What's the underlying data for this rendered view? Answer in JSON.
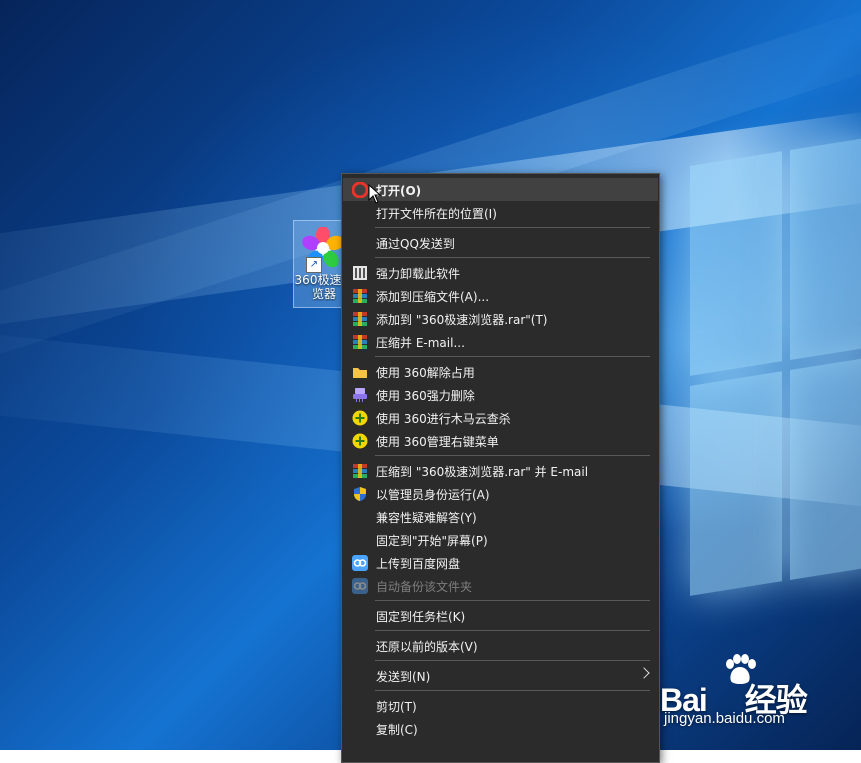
{
  "desktop": {
    "icon_label": "360极速浏览器"
  },
  "context_menu": {
    "items": [
      {
        "label": "打开(O)",
        "icon": "browser-360-icon"
      },
      {
        "label": "打开文件所在的位置(I)",
        "icon": ""
      },
      {
        "label": "通过QQ发送到",
        "icon": ""
      },
      {
        "label": "强力卸载此软件",
        "icon": "uninstall-icon"
      },
      {
        "label": "添加到压缩文件(A)...",
        "icon": "winrar-icon"
      },
      {
        "label": "添加到 \"360极速浏览器.rar\"(T)",
        "icon": "winrar-icon"
      },
      {
        "label": "压缩并 E-mail...",
        "icon": "winrar-icon"
      },
      {
        "label": "使用 360解除占用",
        "icon": "folder-unlock-icon"
      },
      {
        "label": "使用 360强力删除",
        "icon": "shredder-icon"
      },
      {
        "label": "使用 360进行木马云查杀",
        "icon": "360-plus-icon"
      },
      {
        "label": "使用 360管理右键菜单",
        "icon": "360-plus-icon"
      },
      {
        "label": "压缩到 \"360极速浏览器.rar\" 并 E-mail",
        "icon": "winrar-icon"
      },
      {
        "label": "以管理员身份运行(A)",
        "icon": "uac-shield-icon"
      },
      {
        "label": "兼容性疑难解答(Y)",
        "icon": ""
      },
      {
        "label": "固定到\"开始\"屏幕(P)",
        "icon": ""
      },
      {
        "label": "上传到百度网盘",
        "icon": "baidu-netdisk-icon"
      },
      {
        "label": "自动备份该文件夹",
        "icon": "baidu-netdisk-icon"
      },
      {
        "label": "固定到任务栏(K)",
        "icon": ""
      },
      {
        "label": "还原以前的版本(V)",
        "icon": ""
      },
      {
        "label": "发送到(N)",
        "icon": "chevron-right-icon"
      },
      {
        "label": "剪切(T)",
        "icon": ""
      },
      {
        "label": "复制(C)",
        "icon": ""
      }
    ]
  },
  "watermark": {
    "brand_left": "Bai",
    "brand_right": "经验",
    "url": "jingyan.baidu.com"
  }
}
